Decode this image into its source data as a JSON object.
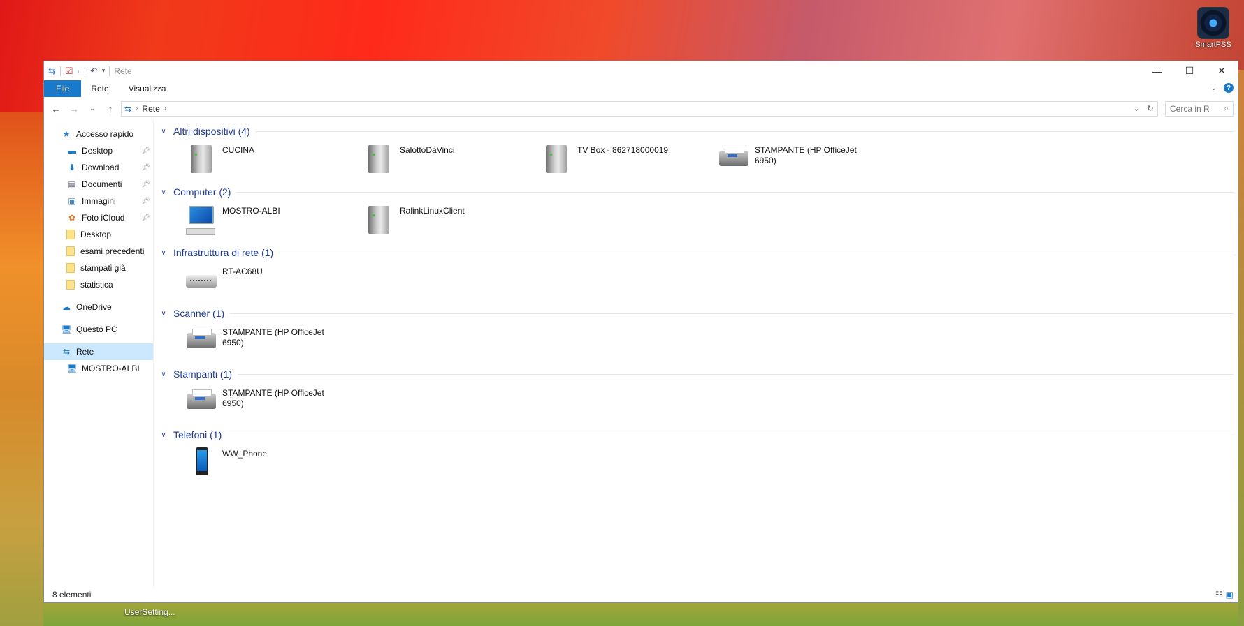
{
  "desktop": {
    "icon_label": "SmartPSS",
    "tooltip": "UserSetting..."
  },
  "window": {
    "title": "Rete",
    "ribbon_tabs": [
      "File",
      "Rete",
      "Visualizza"
    ],
    "help_label": "?",
    "address": {
      "segments": [
        "Rete"
      ]
    },
    "search_placeholder": "Cerca in R"
  },
  "sidebar": {
    "quick_access": "Accesso rapido",
    "pinned": [
      "Desktop",
      "Download",
      "Documenti",
      "Immagini",
      "Foto iCloud"
    ],
    "folders": [
      "Desktop",
      "esami precedenti",
      "stampati già",
      "statistica"
    ],
    "onedrive": "OneDrive",
    "this_pc": "Questo PC",
    "network": "Rete",
    "network_child": "MOSTRO-ALBI"
  },
  "groups": [
    {
      "title": "Altri dispositivi (4)",
      "items": [
        {
          "label": "CUCINA",
          "icon": "server"
        },
        {
          "label": "SalottoDaVinci",
          "icon": "server"
        },
        {
          "label": "TV Box - 862718000019",
          "icon": "server"
        },
        {
          "label": "STAMPANTE (HP OfficeJet 6950)",
          "icon": "printer"
        }
      ]
    },
    {
      "title": "Computer (2)",
      "items": [
        {
          "label": "MOSTRO-ALBI",
          "icon": "computer"
        },
        {
          "label": "RalinkLinuxClient",
          "icon": "server"
        }
      ]
    },
    {
      "title": "Infrastruttura di rete (1)",
      "items": [
        {
          "label": "RT-AC68U",
          "icon": "router"
        }
      ]
    },
    {
      "title": "Scanner (1)",
      "items": [
        {
          "label": "STAMPANTE (HP OfficeJet 6950)",
          "icon": "printer"
        }
      ]
    },
    {
      "title": "Stampanti (1)",
      "items": [
        {
          "label": "STAMPANTE (HP OfficeJet 6950)",
          "icon": "printer"
        }
      ]
    },
    {
      "title": "Telefoni (1)",
      "items": [
        {
          "label": "WW_Phone",
          "icon": "phone"
        }
      ]
    }
  ],
  "status": {
    "count": "8 elementi"
  }
}
